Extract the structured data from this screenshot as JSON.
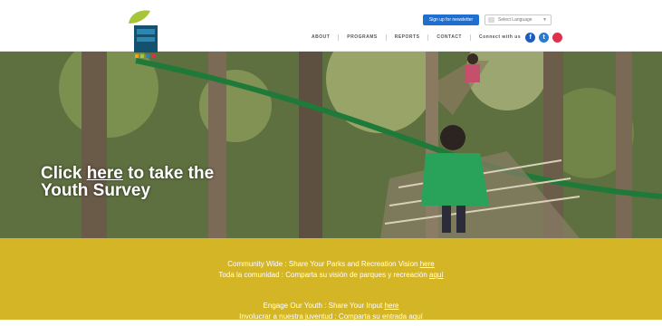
{
  "header": {
    "signup_label": "Sign up for newsletter",
    "language_label": "Select Language",
    "nav": [
      "ABOUT",
      "PROGRAMS",
      "REPORTS",
      "CONTACT",
      "Connect with us"
    ],
    "social": [
      {
        "name": "facebook-icon",
        "glyph": "f",
        "color": "#1d5bbf"
      },
      {
        "name": "twitter-icon",
        "glyph": "t",
        "color": "#2a79d3"
      },
      {
        "name": "instagram-icon",
        "glyph": "",
        "color": "#e0304a"
      }
    ]
  },
  "hero": {
    "cta_prefix": "Click ",
    "cta_link": "here",
    "cta_suffix": " to take the",
    "cta_line2": "Youth Survey"
  },
  "band": {
    "line1_text": "Community Wide : Share Your Parks and Recreation Vision ",
    "line1_link": "here",
    "line2_text": "Toda la comunidad : Comparta su visión de parques y recreación ",
    "line2_link": "aquí",
    "line3_text": "Engage Our Youth : Share Your Input ",
    "line3_link": "here",
    "line4_text": "Involucrar a nuestra juventud : Comparta su entrada ",
    "line4_link": "aquí"
  },
  "colors": {
    "brand_blue": "#1f6fd1",
    "band_yellow": "#d4b526",
    "logo_green": "#a6c53a",
    "logo_navy": "#14516f"
  }
}
